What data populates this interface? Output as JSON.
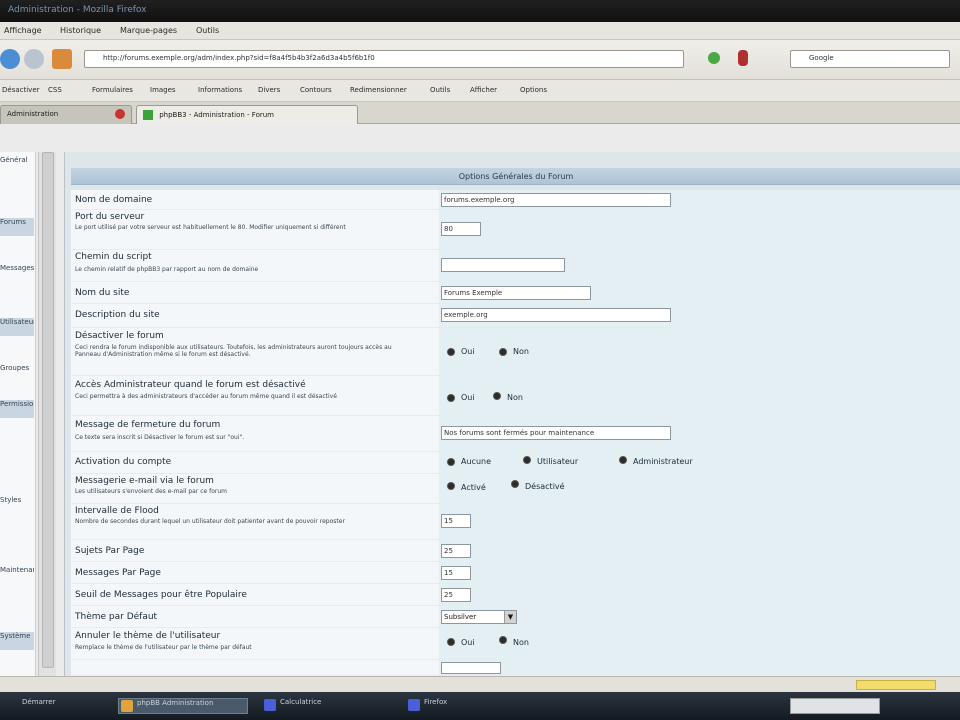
{
  "window": {
    "title": "Administration  -  Mozilla Firefox"
  },
  "menu": {
    "items": [
      "Affichage",
      "Historique",
      "Marque-pages",
      "Outils"
    ]
  },
  "nav": {
    "url": "http://forums.exemple.org/adm/index.php?sid=f8a4f5b4b3f2a6d3a4b5f6b1f0",
    "search_value": "Google"
  },
  "bookmarks": [
    "Désactiver",
    "CSS",
    "Formulaires",
    "Images",
    "Informations",
    "Divers",
    "Contours",
    "Redimensionner",
    "Outils",
    "Afficher",
    "Options"
  ],
  "tabs": [
    {
      "label": "Administration"
    },
    {
      "label": "phpBB3 - Administration - Forum"
    }
  ],
  "sidebar": {
    "items": [
      "Général",
      "Forums",
      "Messages",
      "Utilisateurs",
      "Groupes",
      "Permissions",
      "Styles",
      "Maintenance",
      "Système"
    ]
  },
  "section_title": "Options Générales du Forum",
  "settings": {
    "domain": {
      "label": "Nom de domaine",
      "value": "forums.exemple.org"
    },
    "port": {
      "label": "Port du serveur",
      "hint": "Le port utilisé par votre serveur est habituellement le 80. Modifier uniquement si différent",
      "value": "80"
    },
    "script_path": {
      "label": "Chemin du script",
      "hint": "Le chemin relatif de phpBB3 par rapport au nom de domaine",
      "value": ""
    },
    "site_name": {
      "label": "Nom du site",
      "value": "Forums Exemple"
    },
    "site_desc": {
      "label": "Description du site",
      "value": "exemple.org"
    },
    "disable": {
      "label": "Désactiver le forum",
      "hint": "Ceci rendra le forum indisponible aux utilisateurs. Toutefois, les administrateurs auront toujours accès au Panneau d'Administration même si le forum est désactivé.",
      "opt_yes": "Oui",
      "opt_no": "Non"
    },
    "admin_access": {
      "label": "Accès Administrateur quand le forum est désactivé",
      "hint": "Ceci permettra à des administrateurs d'accéder au forum même quand il est désactivé",
      "opt_yes": "Oui",
      "opt_no": "Non"
    },
    "close_msg": {
      "label": "Message de fermeture du forum",
      "hint": "Ce texte sera inscrit si Désactiver le forum est sur \"oui\".",
      "value": "Nos forums sont fermés pour maintenance"
    },
    "activation": {
      "label": "Activation du compte",
      "opt1": "Aucune",
      "opt2": "Utilisateur",
      "opt3": "Administrateur"
    },
    "email": {
      "label": "Messagerie e-mail via le forum",
      "hint": "Les utilisateurs s'envoient des e-mail par ce forum",
      "opt_on": "Activé",
      "opt_off": "Désactivé"
    },
    "flood": {
      "label": "Intervalle de Flood",
      "hint": "Nombre de secondes durant lequel un utilisateur doit patienter avant de pouvoir reposter",
      "value": "15"
    },
    "topics_per_page": {
      "label": "Sujets Par Page",
      "value": "25"
    },
    "posts_per_page": {
      "label": "Messages Par Page",
      "value": "15"
    },
    "hot_threshold": {
      "label": "Seuil de Messages pour être Populaire",
      "value": "25"
    },
    "default_style": {
      "label": "Thème par Défaut",
      "value": "Subsilver"
    },
    "override_style": {
      "label": "Annuler le thème de l'utilisateur",
      "hint": "Remplace le thème de l'utilisateur par le thème par défaut",
      "opt_yes": "Oui",
      "opt_no": "Non"
    }
  },
  "taskbar": {
    "items": [
      "Démarrer",
      "phpBB Administration",
      "Calculatrice",
      "Firefox"
    ]
  }
}
